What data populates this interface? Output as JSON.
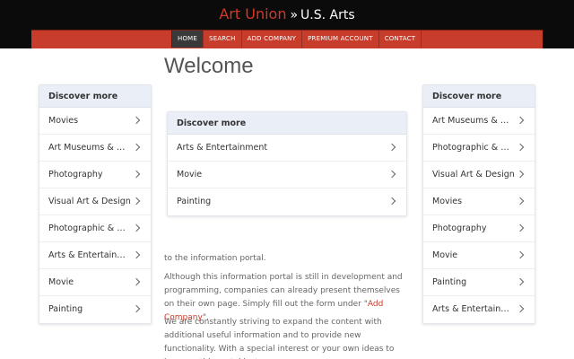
{
  "header": {
    "brand_part1": "Art Union",
    "separator": "»",
    "brand_part2": "U.S. Arts"
  },
  "nav": {
    "items": [
      "HOME",
      "SEARCH",
      "ADD COMPANY",
      "PREMIUM ACCOUNT",
      "CONTACT"
    ],
    "active_index": 0
  },
  "main": {
    "title": "Welcome",
    "intro": "to the information portal.",
    "p2_text": "Although this information portal is still in development and programming, companies can already present themselves on their own page. Simply fill out the form under \"",
    "p2_link": "Add Company",
    "p2_end": "\".",
    "p3_text": "We are constantly striving to expand the content with additional useful information and to provide new functionality. With a special interest or your own ideas to improve this portal just"
  },
  "cards": {
    "left": {
      "title": "Discover more",
      "items": [
        "Movies",
        "Art Museums & Galleries",
        "Photography",
        "Visual Art & Design",
        "Photographic & Digital Arts",
        "Arts & Entertainment",
        "Movie",
        "Painting"
      ]
    },
    "center": {
      "title": "Discover more",
      "items": [
        "Arts & Entertainment",
        "Movie",
        "Painting"
      ]
    },
    "right": {
      "title": "Discover more",
      "items": [
        "Art Museums & Galleries",
        "Photographic & Digital Arts",
        "Visual Art & Design",
        "Movies",
        "Photography",
        "Movie",
        "Painting",
        "Arts & Entertainment"
      ]
    }
  },
  "colors": {
    "header_bg": "#0b0b0b",
    "nav_red": "#c73c2b",
    "brand_red": "#d23a26",
    "card_head_bg": "#e9eef7"
  },
  "icons": {
    "item_icon": "chevron-right-icon"
  }
}
